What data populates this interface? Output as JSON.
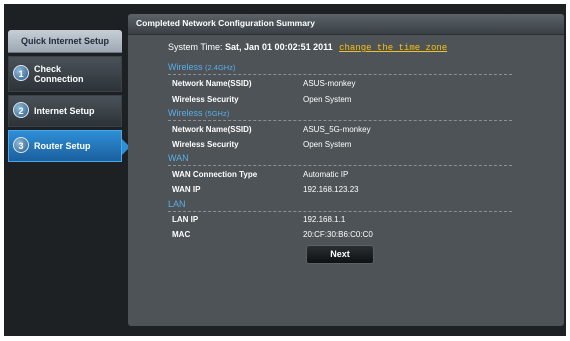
{
  "sidebar": {
    "header": "Quick Internet Setup",
    "items": [
      {
        "num": "1",
        "label_line1": "Check",
        "label_line2": "Connection"
      },
      {
        "num": "2",
        "label": "Internet Setup"
      },
      {
        "num": "3",
        "label": "Router Setup"
      }
    ]
  },
  "panel": {
    "title": "Completed Network Configuration Summary",
    "system_time_label": "System Time:",
    "system_time_value": "Sat, Jan 01 00:02:51 2011",
    "change_zone_link": "change the time zone",
    "sections": {
      "wireless24": {
        "title": "Wireless",
        "band": "(2.4GHz)",
        "ssid_label": "Network Name(SSID)",
        "ssid_value": "ASUS-monkey",
        "security_label": "Wireless Security",
        "security_value": "Open System"
      },
      "wireless5": {
        "title": "Wireless",
        "band": "(5GHz)",
        "ssid_label": "Network Name(SSID)",
        "ssid_value": "ASUS_5G-monkey",
        "security_label": "Wireless Security",
        "security_value": "Open System"
      },
      "wan": {
        "title": "WAN",
        "type_label": "WAN Connection Type",
        "type_value": "Automatic IP",
        "ip_label": "WAN IP",
        "ip_value": "192.168.123.23"
      },
      "lan": {
        "title": "LAN",
        "ip_label": "LAN IP",
        "ip_value": "192.168.1.1",
        "mac_label": "MAC",
        "mac_value": "20:CF:30:B6:C0:C0"
      }
    },
    "next_button": "Next"
  }
}
